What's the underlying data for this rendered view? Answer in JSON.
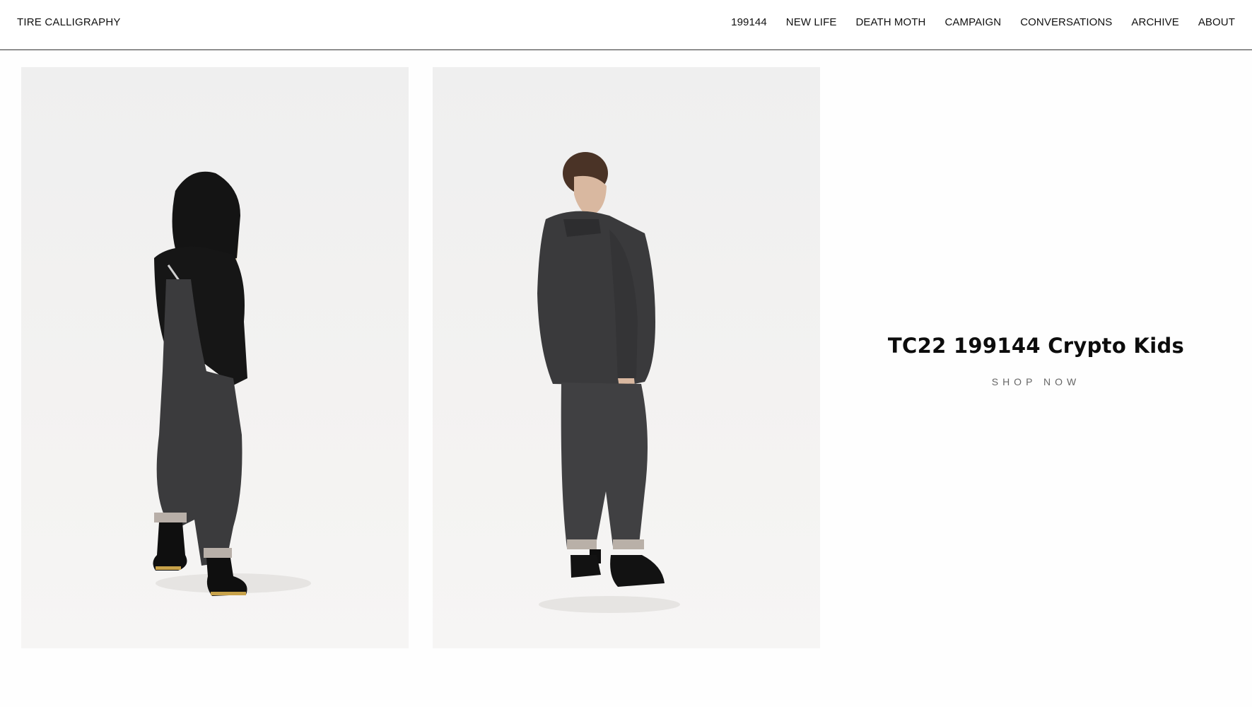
{
  "header": {
    "brand": "TIRE CALLIGRAPHY",
    "nav": [
      "199144",
      "NEW LIFE",
      "DEATH MOTH",
      "CAMPAIGN",
      "CONVERSATIONS",
      "ARCHIVE",
      "ABOUT"
    ]
  },
  "promo": {
    "title": "TC22 199144 Crypto Kids",
    "cta": "SHOP NOW"
  },
  "colors": {
    "text": "#111111",
    "cta": "#666666",
    "divider": "#333333"
  }
}
